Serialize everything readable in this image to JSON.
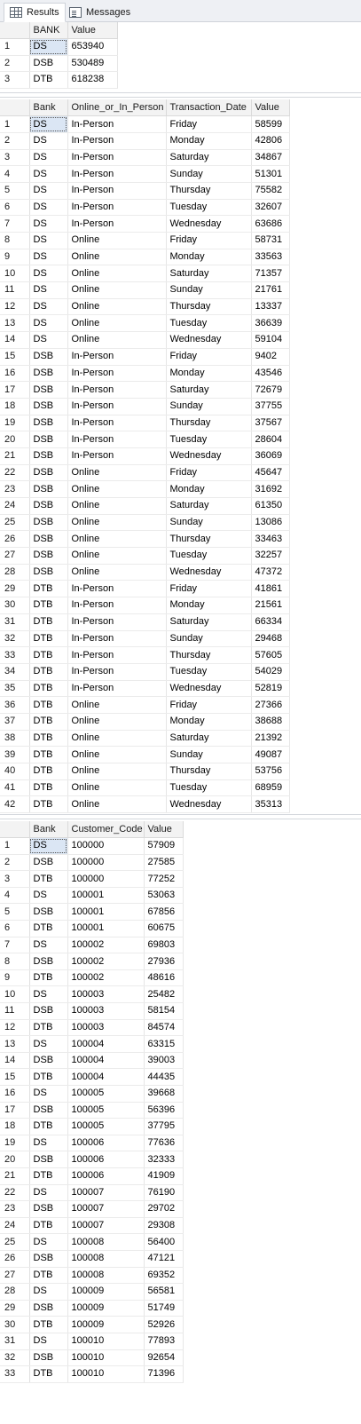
{
  "tabs": [
    {
      "label": "Results",
      "icon": "results-grid-icon",
      "active": true
    },
    {
      "label": "Messages",
      "icon": "messages-icon",
      "active": false
    }
  ],
  "grid1": {
    "columns": [
      "BANK",
      "Value"
    ],
    "rows": [
      [
        "1",
        "DS",
        "653940"
      ],
      [
        "2",
        "DSB",
        "530489"
      ],
      [
        "3",
        "DTB",
        "618238"
      ]
    ]
  },
  "grid2": {
    "columns": [
      "Bank",
      "Online_or_In_Person",
      "Transaction_Date",
      "Value"
    ],
    "rows": [
      [
        "1",
        "DS",
        "In-Person",
        "Friday",
        "58599"
      ],
      [
        "2",
        "DS",
        "In-Person",
        "Monday",
        "42806"
      ],
      [
        "3",
        "DS",
        "In-Person",
        "Saturday",
        "34867"
      ],
      [
        "4",
        "DS",
        "In-Person",
        "Sunday",
        "51301"
      ],
      [
        "5",
        "DS",
        "In-Person",
        "Thursday",
        "75582"
      ],
      [
        "6",
        "DS",
        "In-Person",
        "Tuesday",
        "32607"
      ],
      [
        "7",
        "DS",
        "In-Person",
        "Wednesday",
        "63686"
      ],
      [
        "8",
        "DS",
        "Online",
        "Friday",
        "58731"
      ],
      [
        "9",
        "DS",
        "Online",
        "Monday",
        "33563"
      ],
      [
        "10",
        "DS",
        "Online",
        "Saturday",
        "71357"
      ],
      [
        "11",
        "DS",
        "Online",
        "Sunday",
        "21761"
      ],
      [
        "12",
        "DS",
        "Online",
        "Thursday",
        "13337"
      ],
      [
        "13",
        "DS",
        "Online",
        "Tuesday",
        "36639"
      ],
      [
        "14",
        "DS",
        "Online",
        "Wednesday",
        "59104"
      ],
      [
        "15",
        "DSB",
        "In-Person",
        "Friday",
        "9402"
      ],
      [
        "16",
        "DSB",
        "In-Person",
        "Monday",
        "43546"
      ],
      [
        "17",
        "DSB",
        "In-Person",
        "Saturday",
        "72679"
      ],
      [
        "18",
        "DSB",
        "In-Person",
        "Sunday",
        "37755"
      ],
      [
        "19",
        "DSB",
        "In-Person",
        "Thursday",
        "37567"
      ],
      [
        "20",
        "DSB",
        "In-Person",
        "Tuesday",
        "28604"
      ],
      [
        "21",
        "DSB",
        "In-Person",
        "Wednesday",
        "36069"
      ],
      [
        "22",
        "DSB",
        "Online",
        "Friday",
        "45647"
      ],
      [
        "23",
        "DSB",
        "Online",
        "Monday",
        "31692"
      ],
      [
        "24",
        "DSB",
        "Online",
        "Saturday",
        "61350"
      ],
      [
        "25",
        "DSB",
        "Online",
        "Sunday",
        "13086"
      ],
      [
        "26",
        "DSB",
        "Online",
        "Thursday",
        "33463"
      ],
      [
        "27",
        "DSB",
        "Online",
        "Tuesday",
        "32257"
      ],
      [
        "28",
        "DSB",
        "Online",
        "Wednesday",
        "47372"
      ],
      [
        "29",
        "DTB",
        "In-Person",
        "Friday",
        "41861"
      ],
      [
        "30",
        "DTB",
        "In-Person",
        "Monday",
        "21561"
      ],
      [
        "31",
        "DTB",
        "In-Person",
        "Saturday",
        "66334"
      ],
      [
        "32",
        "DTB",
        "In-Person",
        "Sunday",
        "29468"
      ],
      [
        "33",
        "DTB",
        "In-Person",
        "Thursday",
        "57605"
      ],
      [
        "34",
        "DTB",
        "In-Person",
        "Tuesday",
        "54029"
      ],
      [
        "35",
        "DTB",
        "In-Person",
        "Wednesday",
        "52819"
      ],
      [
        "36",
        "DTB",
        "Online",
        "Friday",
        "27366"
      ],
      [
        "37",
        "DTB",
        "Online",
        "Monday",
        "38688"
      ],
      [
        "38",
        "DTB",
        "Online",
        "Saturday",
        "21392"
      ],
      [
        "39",
        "DTB",
        "Online",
        "Sunday",
        "49087"
      ],
      [
        "40",
        "DTB",
        "Online",
        "Thursday",
        "53756"
      ],
      [
        "41",
        "DTB",
        "Online",
        "Tuesday",
        "68959"
      ],
      [
        "42",
        "DTB",
        "Online",
        "Wednesday",
        "35313"
      ]
    ]
  },
  "grid3": {
    "columns": [
      "Bank",
      "Customer_Code",
      "Value"
    ],
    "rows": [
      [
        "1",
        "DS",
        "100000",
        "57909"
      ],
      [
        "2",
        "DSB",
        "100000",
        "27585"
      ],
      [
        "3",
        "DTB",
        "100000",
        "77252"
      ],
      [
        "4",
        "DS",
        "100001",
        "53063"
      ],
      [
        "5",
        "DSB",
        "100001",
        "67856"
      ],
      [
        "6",
        "DTB",
        "100001",
        "60675"
      ],
      [
        "7",
        "DS",
        "100002",
        "69803"
      ],
      [
        "8",
        "DSB",
        "100002",
        "27936"
      ],
      [
        "9",
        "DTB",
        "100002",
        "48616"
      ],
      [
        "10",
        "DS",
        "100003",
        "25482"
      ],
      [
        "11",
        "DSB",
        "100003",
        "58154"
      ],
      [
        "12",
        "DTB",
        "100003",
        "84574"
      ],
      [
        "13",
        "DS",
        "100004",
        "63315"
      ],
      [
        "14",
        "DSB",
        "100004",
        "39003"
      ],
      [
        "15",
        "DTB",
        "100004",
        "44435"
      ],
      [
        "16",
        "DS",
        "100005",
        "39668"
      ],
      [
        "17",
        "DSB",
        "100005",
        "56396"
      ],
      [
        "18",
        "DTB",
        "100005",
        "37795"
      ],
      [
        "19",
        "DS",
        "100006",
        "77636"
      ],
      [
        "20",
        "DSB",
        "100006",
        "32333"
      ],
      [
        "21",
        "DTB",
        "100006",
        "41909"
      ],
      [
        "22",
        "DS",
        "100007",
        "76190"
      ],
      [
        "23",
        "DSB",
        "100007",
        "29702"
      ],
      [
        "24",
        "DTB",
        "100007",
        "29308"
      ],
      [
        "25",
        "DS",
        "100008",
        "56400"
      ],
      [
        "26",
        "DSB",
        "100008",
        "47121"
      ],
      [
        "27",
        "DTB",
        "100008",
        "69352"
      ],
      [
        "28",
        "DS",
        "100009",
        "56581"
      ],
      [
        "29",
        "DSB",
        "100009",
        "51749"
      ],
      [
        "30",
        "DTB",
        "100009",
        "52926"
      ],
      [
        "31",
        "DS",
        "100010",
        "77893"
      ],
      [
        "32",
        "DSB",
        "100010",
        "92654"
      ],
      [
        "33",
        "DTB",
        "100010",
        "71396"
      ]
    ]
  },
  "colors": {
    "selected_cell": "#dbe6f4",
    "header_bg": "#f3f3f3",
    "tabbar_bg": "#eef0f4"
  }
}
